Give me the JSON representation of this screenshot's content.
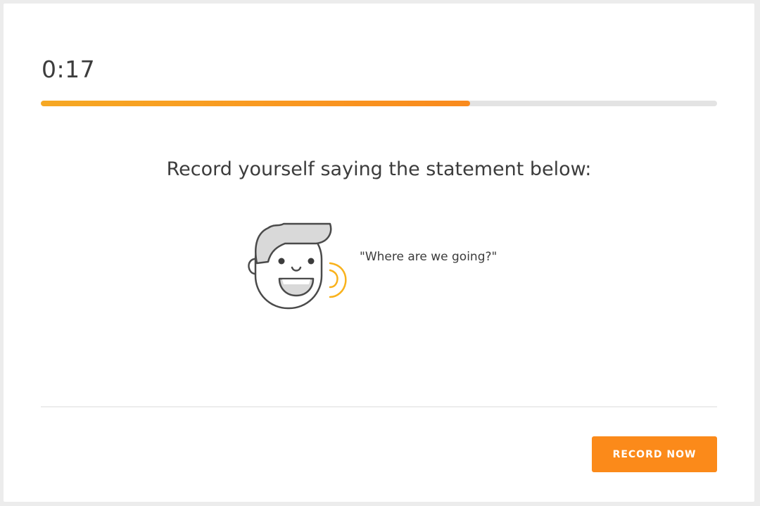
{
  "timer": {
    "text": "0:17"
  },
  "progress": {
    "fraction": 0.635
  },
  "prompt": {
    "text": "Record yourself saying the statement below:"
  },
  "illustration": {
    "icon": "speaking-face-icon"
  },
  "statement": {
    "text": "\"Where are we going?\""
  },
  "actions": {
    "record_label": "RECORD NOW"
  },
  "colors": {
    "accent": "#fb8a1a",
    "progress_start": "#f6a823",
    "progress_end": "#f98a1d",
    "track": "#e3e3e3",
    "text": "#3c3c3c"
  }
}
